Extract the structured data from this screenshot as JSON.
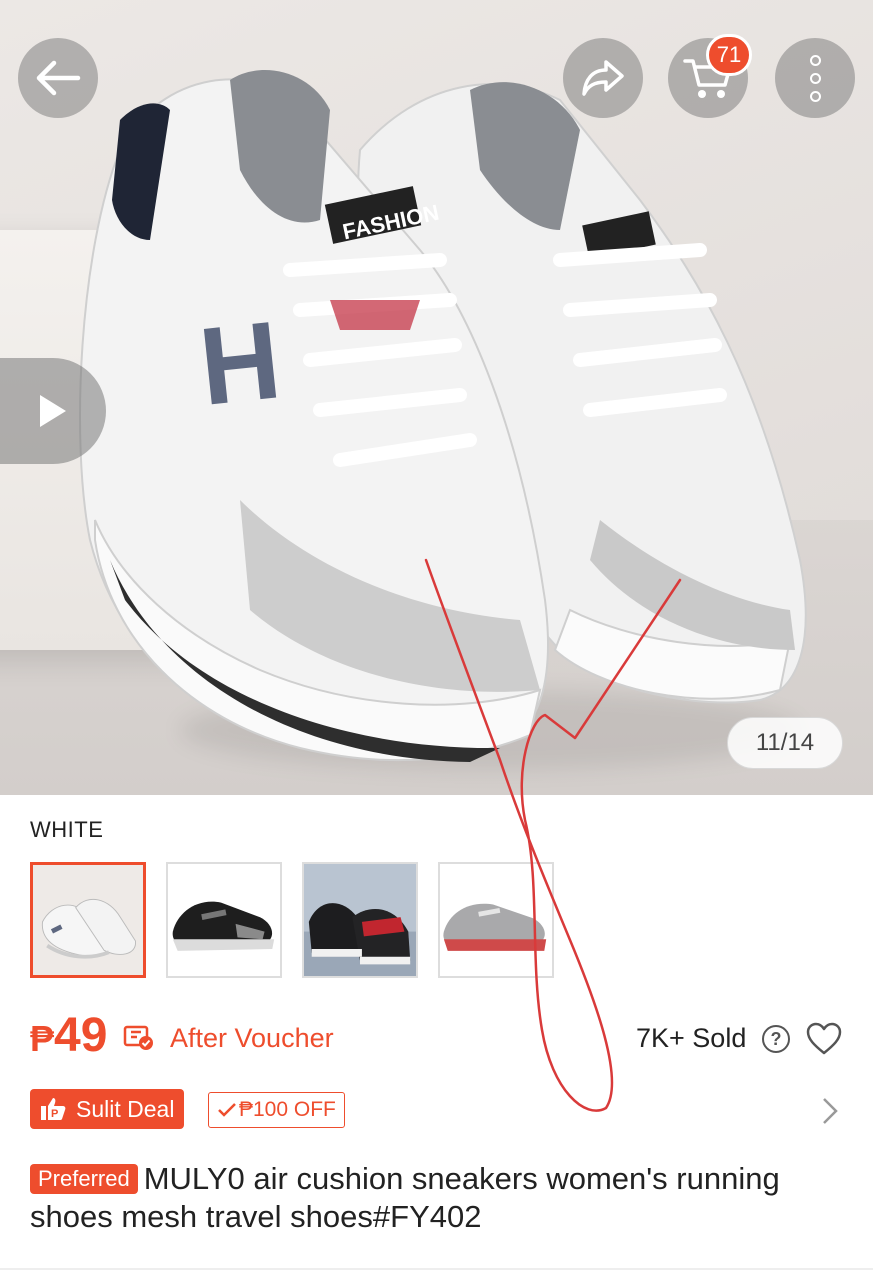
{
  "header": {
    "back_icon": "arrow-left-icon",
    "share_icon": "share-icon",
    "cart_icon": "cart-icon",
    "cart_count": "71",
    "more_icon": "more-vertical-icon"
  },
  "gallery": {
    "counter": "11/14",
    "play_icon": "play-icon",
    "shoe_tag_text": "FASHION"
  },
  "variant": {
    "label": "WHITE",
    "options": [
      "white",
      "black",
      "black-red",
      "grey-red"
    ]
  },
  "pricing": {
    "currency": "₱",
    "price": "49",
    "after_voucher": "After Voucher",
    "sold": "7K+ Sold",
    "help": "?"
  },
  "promo": {
    "deal_label": "Sulit Deal",
    "off_label": "₱100 OFF"
  },
  "product": {
    "badge": "Preferred",
    "title": "MULY0 air cushion sneakers women's running shoes mesh travel shoes#FY402"
  },
  "colors": {
    "accent": "#ee4d2d",
    "overlay": "rgba(130,130,130,0.55)"
  }
}
